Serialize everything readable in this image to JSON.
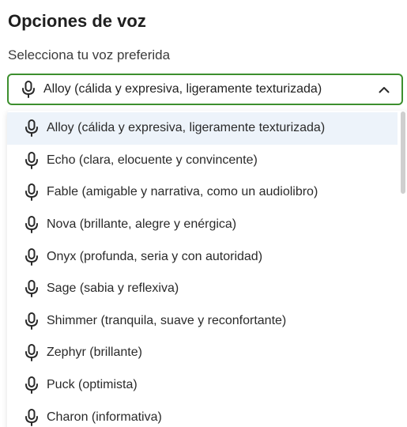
{
  "header": {
    "title": "Opciones de voz",
    "subtitle": "Selecciona tu voz preferida"
  },
  "select": {
    "value": "Alloy (cálida y expresiva, ligeramente texturizada)",
    "icon": "microphone-icon",
    "toggle_icon": "chevron-up-icon",
    "border_color": "#3d8f2e"
  },
  "options": [
    {
      "label": "Alloy (cálida y expresiva, ligeramente texturizada)",
      "selected": true
    },
    {
      "label": "Echo (clara, elocuente y convincente)"
    },
    {
      "label": "Fable (amigable y narrativa, como un audiolibro)"
    },
    {
      "label": "Nova (brillante, alegre y enérgica)"
    },
    {
      "label": "Onyx (profunda, seria y con autoridad)"
    },
    {
      "label": "Sage (sabia y reflexiva)"
    },
    {
      "label": "Shimmer (tranquila, suave y reconfortante)"
    },
    {
      "label": "Zephyr (brillante)"
    },
    {
      "label": "Puck (optimista)"
    },
    {
      "label": "Charon (informativa)"
    }
  ],
  "colors": {
    "accent": "#3d8f2e",
    "selected_bg": "#edf3fa"
  }
}
